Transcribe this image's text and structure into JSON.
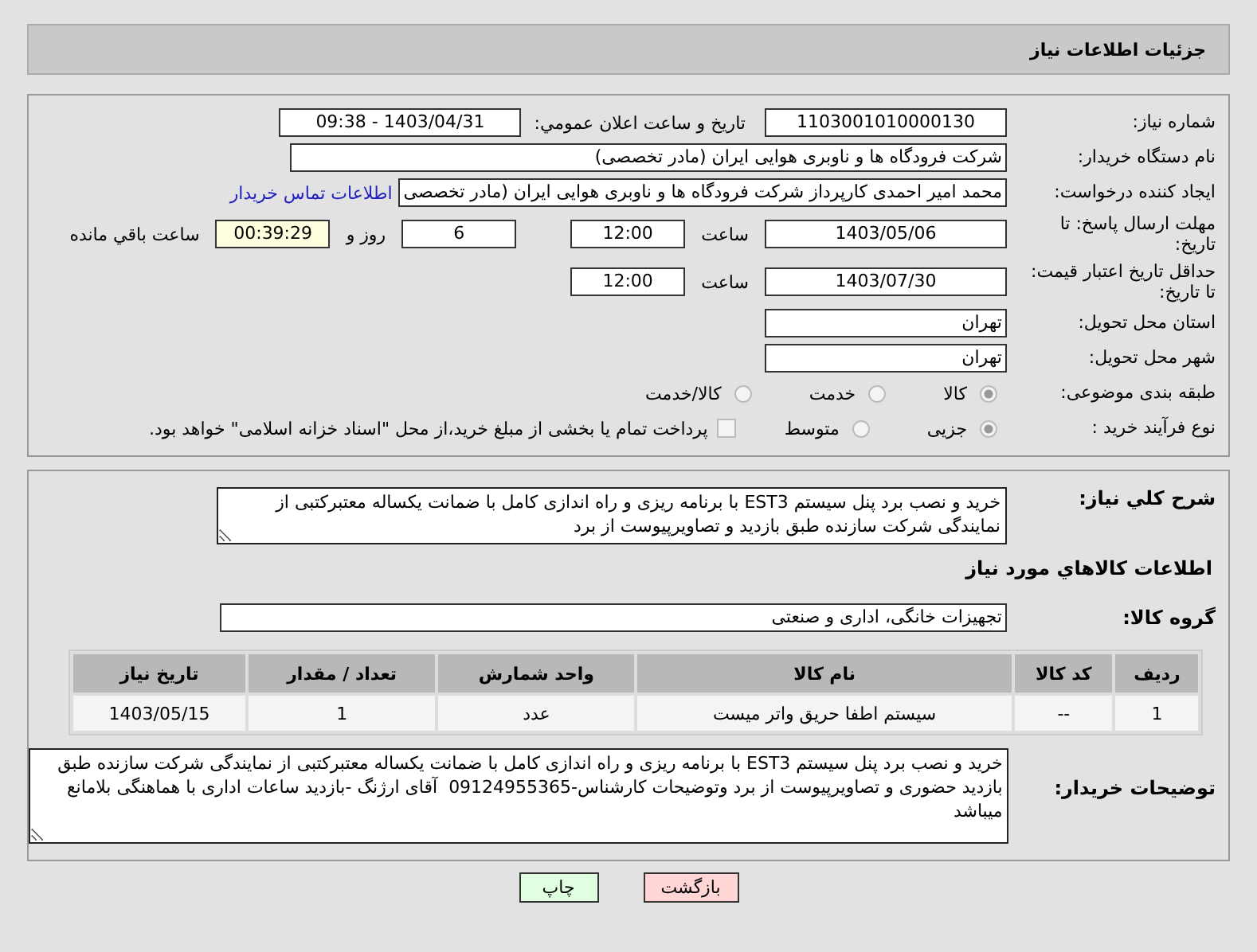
{
  "header": {
    "title": "جزئیات اطلاعات نیاز"
  },
  "need_number": {
    "label": "شماره نیاز:",
    "value": "1103001010000130"
  },
  "announce": {
    "label": "تاریخ و ساعت اعلان عمومي:",
    "value": "1403/04/31 - 09:38"
  },
  "buyer": {
    "label": "نام دستگاه خریدار:",
    "value": "شرکت فرودگاه ها و ناوبری هوایی ایران (مادر تخصصی)"
  },
  "requester": {
    "label": "ایجاد کننده درخواست:",
    "value": "محمد امیر احمدی کارپرداز شرکت فرودگاه ها و ناوبری هوایی ایران (مادر تخصصی",
    "link": "اطلاعات تماس خریدار"
  },
  "deadline": {
    "label": "مهلت ارسال پاسخ: تا تاریخ:",
    "date": "1403/05/06",
    "time_label": "ساعت",
    "time": "12:00",
    "days": "6",
    "days_label": "روز و",
    "remaining": "00:39:29",
    "remaining_label": "ساعت باقي مانده"
  },
  "validity": {
    "label": "حداقل تاریخ اعتبار قیمت: تا تاریخ:",
    "date": "1403/07/30",
    "time_label": "ساعت",
    "time": "12:00"
  },
  "province": {
    "label": "استان محل تحویل:",
    "value": "تهران"
  },
  "city": {
    "label": "شهر محل تحویل:",
    "value": "تهران"
  },
  "category": {
    "label": "طبقه بندی موضوعی:",
    "options": [
      {
        "label": "کالا",
        "selected": true
      },
      {
        "label": "خدمت",
        "selected": false
      },
      {
        "label": "کالا/خدمت",
        "selected": false
      }
    ]
  },
  "purchase_type": {
    "label": "نوع فرآیند خرید :",
    "options": [
      {
        "label": "جزیی",
        "selected": true
      },
      {
        "label": "متوسط",
        "selected": false
      }
    ],
    "treasury": {
      "label": "پرداخت تمام یا بخشی از مبلغ خرید،از محل \"اسناد خزانه اسلامی\" خواهد بود.",
      "checked": false
    }
  },
  "summary": {
    "label": "شرح کلي نياز:",
    "text": "خرید و نصب برد پنل سیستم EST3 با برنامه ریزی و راه اندازی کامل با ضمانت یکساله معتبرکتبی از نمایندگی شرکت سازنده طبق بازدید و تصاویرپیوست از برد"
  },
  "goods_heading": "اطلاعات کالاهاي مورد نياز",
  "goods_group": {
    "label": "گروه کالا:",
    "value": "تجهيزات خانگی، اداری و صنعتی"
  },
  "table": {
    "columns": [
      "ردیف",
      "کد کالا",
      "نام کالا",
      "واحد شمارش",
      "تعداد / مقدار",
      "تاریخ نیاز"
    ],
    "rows": [
      [
        "1",
        "--",
        "سیستم اطفا حریق واتر میست",
        "عدد",
        "1",
        "1403/05/15"
      ]
    ]
  },
  "notes": {
    "label": "توضیحات خریدار:",
    "text": "خرید و نصب برد پنل سیستم EST3 با برنامه ریزی و راه اندازی کامل با ضمانت یکساله معتبرکتبی از نمایندگی شرکت سازنده طبق بازدید حضوری و تصاویرپیوست از برد وتوضیحات کارشناس-09124955365  آقای ارژنگ -بازدید ساعات اداری با هماهنگی بلامانع میباشد"
  },
  "buttons": [
    {
      "label": "بازگشت",
      "kind": "back"
    },
    {
      "label": "چاپ",
      "kind": "print"
    }
  ]
}
